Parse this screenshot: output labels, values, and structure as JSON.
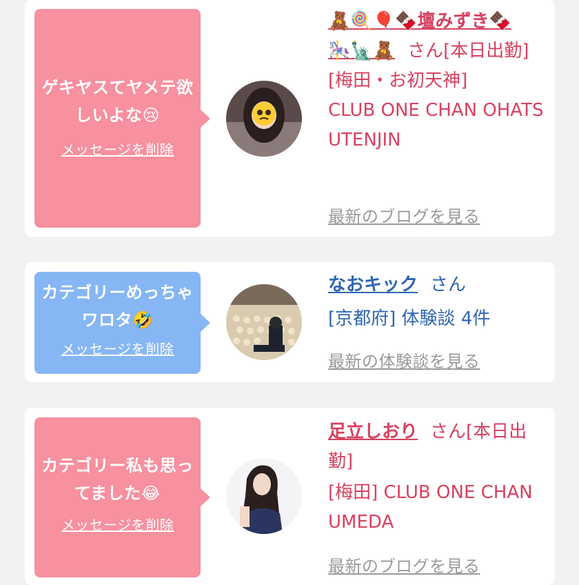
{
  "cards": [
    {
      "message": "ゲキヤスてヤメテ欲しいよな😢",
      "delete_label": "メッセージを削除",
      "name_line1": "🧸🍭🎈🍫壇みずき🍫",
      "name_line2": "🎠🗽🧸",
      "san": "さん",
      "status": "[本日出勤]",
      "location": "[梅田・お初天神]",
      "shop": "CLUB ONE CHAN OHATSUTENJIN",
      "link": "最新のブログを見る"
    },
    {
      "message": "カテゴリーめっちゃワロタ🤣",
      "delete_label": "メッセージを削除",
      "name": "なおキック",
      "san": "さん",
      "detail": "[京都府] 体験談 4件",
      "link": "最新の体験談を見る"
    },
    {
      "message": "カテゴリー私も思ってました😂",
      "delete_label": "メッセージを削除",
      "name": "足立しおり",
      "san": "さん",
      "status": "[本日出勤]",
      "detail": "[梅田] CLUB ONE CHAN UMEDA",
      "link": "最新のブログを見る"
    }
  ],
  "colors": {
    "pink_bubble": "#f7909f",
    "blue_bubble": "#86b6f4",
    "pink_text": "#d7415f",
    "blue_text": "#2e65b4",
    "link_gray": "#9a9a9a"
  }
}
